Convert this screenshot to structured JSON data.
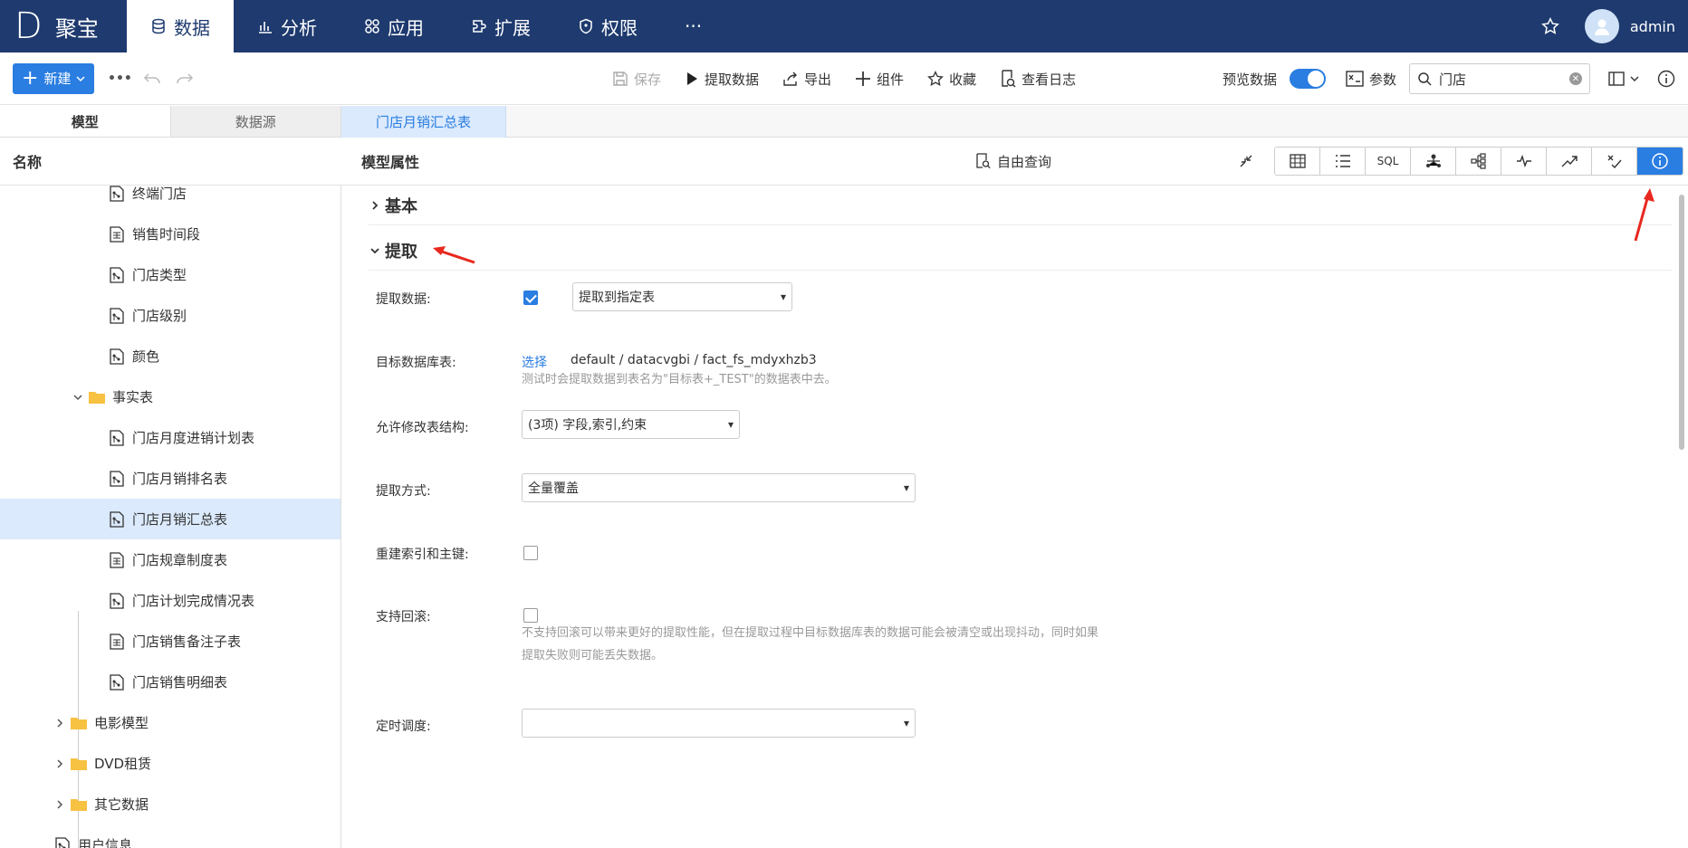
{
  "app": {
    "logo_letter": "D",
    "name": "聚宝",
    "user": "admin"
  },
  "nav": [
    {
      "label": "数据",
      "icon": "database-icon",
      "active": true
    },
    {
      "label": "分析",
      "icon": "bar-chart-icon",
      "active": false
    },
    {
      "label": "应用",
      "icon": "apps-icon",
      "active": false
    },
    {
      "label": "扩展",
      "icon": "puzzle-icon",
      "active": false
    },
    {
      "label": "权限",
      "icon": "shield-icon",
      "active": false
    },
    {
      "label": "···",
      "icon": "more-icon",
      "active": false
    }
  ],
  "toolbar": {
    "new_label": "新建",
    "more": "•••",
    "save": "保存",
    "extract": "提取数据",
    "export": "导出",
    "component": "组件",
    "favorite": "收藏",
    "log": "查看日志",
    "preview": "预览数据",
    "params": "参数",
    "search_value": "门店"
  },
  "left": {
    "tabs": [
      "模型",
      "数据源"
    ],
    "header": "名称",
    "tree": [
      {
        "label": "终端门店",
        "type": "model"
      },
      {
        "label": "销售时间段",
        "type": "table"
      },
      {
        "label": "门店类型",
        "type": "model"
      },
      {
        "label": "门店级别",
        "type": "model"
      },
      {
        "label": "颜色",
        "type": "model"
      },
      {
        "label": "事实表",
        "type": "folder"
      },
      {
        "label": "门店月度进销计划表",
        "type": "model"
      },
      {
        "label": "门店月销排名表",
        "type": "model"
      },
      {
        "label": "门店月销汇总表",
        "type": "model"
      },
      {
        "label": "门店规章制度表",
        "type": "table"
      },
      {
        "label": "门店计划完成情况表",
        "type": "model"
      },
      {
        "label": "门店销售备注子表",
        "type": "table"
      },
      {
        "label": "门店销售明细表",
        "type": "model"
      },
      {
        "label": "电影模型",
        "type": "folder"
      },
      {
        "label": "DVD租赁",
        "type": "folder"
      },
      {
        "label": "其它数据",
        "type": "folder"
      },
      {
        "label": "用户信息",
        "type": "model"
      }
    ]
  },
  "main": {
    "doc_tab": "门店月销汇总表",
    "title": "模型属性",
    "free_query": "自由查询",
    "view_sql": "SQL",
    "sections": {
      "basic": "基本",
      "extract": "提取"
    },
    "form": {
      "extract_label": "提取数据:",
      "extract_checked": true,
      "extract_select": "提取到指定表",
      "target_label": "目标数据库表:",
      "target_link": "选择",
      "target_value": "default / datacvgbi / fact_fs_mdyxhzb3",
      "target_help": "测试时会提取数据到表名为\"目标表+_TEST\"的数据表中去。",
      "alter_label": "允许修改表结构:",
      "alter_select": "(3项) 字段,索引,约束",
      "mode_label": "提取方式:",
      "mode_select": "全量覆盖",
      "rebuild_label": "重建索引和主键:",
      "rebuild_checked": false,
      "rollback_label": "支持回滚:",
      "rollback_checked": false,
      "rollback_help1": "不支持回滚可以带来更好的提取性能，但在提取过程中目标数据库表的数据可能会被清空或出现抖动，同时如果",
      "rollback_help2": "提取失败则可能丢失数据。",
      "schedule_label": "定时调度:",
      "schedule_select": ""
    }
  },
  "colors": {
    "nav_bg": "#1e3a6e",
    "accent": "#2a7de1",
    "selected_row": "#dbeafc",
    "annotation": "#e8281e"
  }
}
